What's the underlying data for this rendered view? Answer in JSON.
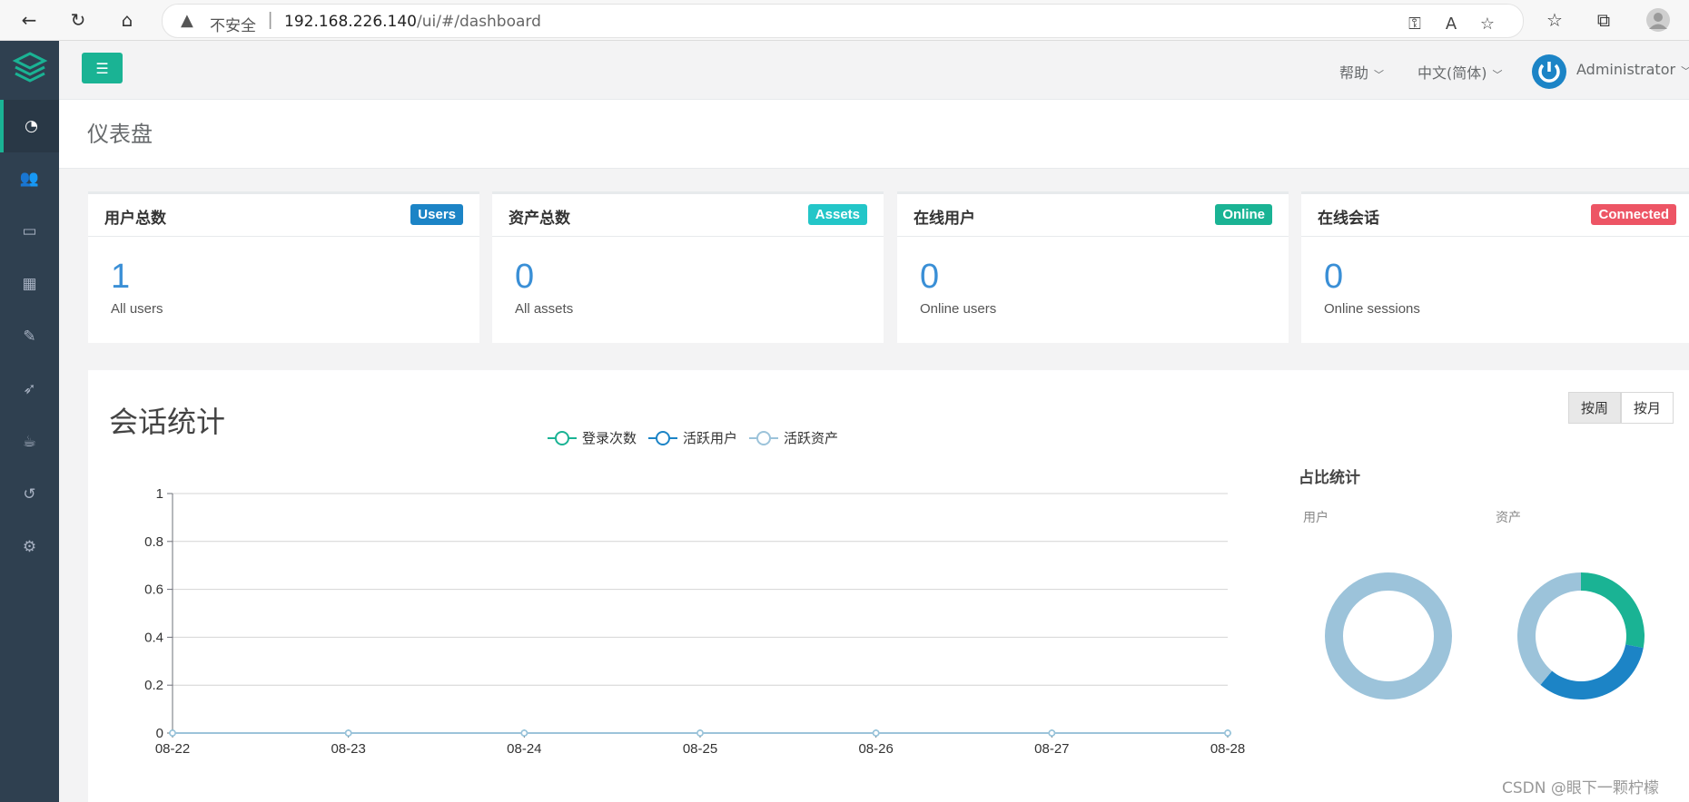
{
  "browser": {
    "insecure_label": "不安全",
    "url_host": "192.168.226.140",
    "url_path": "/ui/#/dashboard"
  },
  "topnav": {
    "help": "帮助",
    "language": "中文(简体)",
    "user": "Administrator"
  },
  "page": {
    "title": "仪表盘"
  },
  "cards": [
    {
      "title": "用户总数",
      "badge": "Users",
      "badge_color": "#1c84c6",
      "value": "1",
      "desc": "All users"
    },
    {
      "title": "资产总数",
      "badge": "Assets",
      "badge_color": "#23c6c8",
      "value": "0",
      "desc": "All assets"
    },
    {
      "title": "在线用户",
      "badge": "Online",
      "badge_color": "#1ab394",
      "value": "0",
      "desc": "Online users"
    },
    {
      "title": "在线会话",
      "badge": "Connected",
      "badge_color": "#ed5565",
      "value": "0",
      "desc": "Online sessions"
    }
  ],
  "panel": {
    "title": "会话统计",
    "btn_week": "按周",
    "btn_month": "按月",
    "ratio_title": "占比统计",
    "ratio_users": "用户",
    "ratio_assets": "资产"
  },
  "watermark": "CSDN @眼下一颗柠檬",
  "chart_data": [
    {
      "type": "line",
      "x": [
        "08-22",
        "08-23",
        "08-24",
        "08-25",
        "08-26",
        "08-27",
        "08-28"
      ],
      "series": [
        {
          "name": "登录次数",
          "color": "#1ab394",
          "values": [
            0,
            0,
            0,
            0,
            0,
            0,
            0
          ]
        },
        {
          "name": "活跃用户",
          "color": "#1c84c6",
          "values": [
            0,
            0,
            0,
            0,
            0,
            0,
            0
          ]
        },
        {
          "name": "活跃资产",
          "color": "#9cc3da",
          "values": [
            0,
            0,
            0,
            0,
            0,
            0,
            0
          ]
        }
      ],
      "yticks": [
        "0",
        "0.2",
        "0.4",
        "0.6",
        "0.8",
        "1"
      ],
      "ylim": [
        0,
        1
      ],
      "legend": "top",
      "grid": true
    },
    {
      "type": "pie",
      "donut": true,
      "label": "用户",
      "slices": [
        {
          "value": 1,
          "color": "#9cc3da"
        }
      ]
    },
    {
      "type": "pie",
      "donut": true,
      "label": "资产",
      "slices": [
        {
          "value": 0.28,
          "color": "#1ab394"
        },
        {
          "value": 0.33,
          "color": "#1c84c6"
        },
        {
          "value": 0.39,
          "color": "#9cc3da"
        }
      ]
    }
  ]
}
